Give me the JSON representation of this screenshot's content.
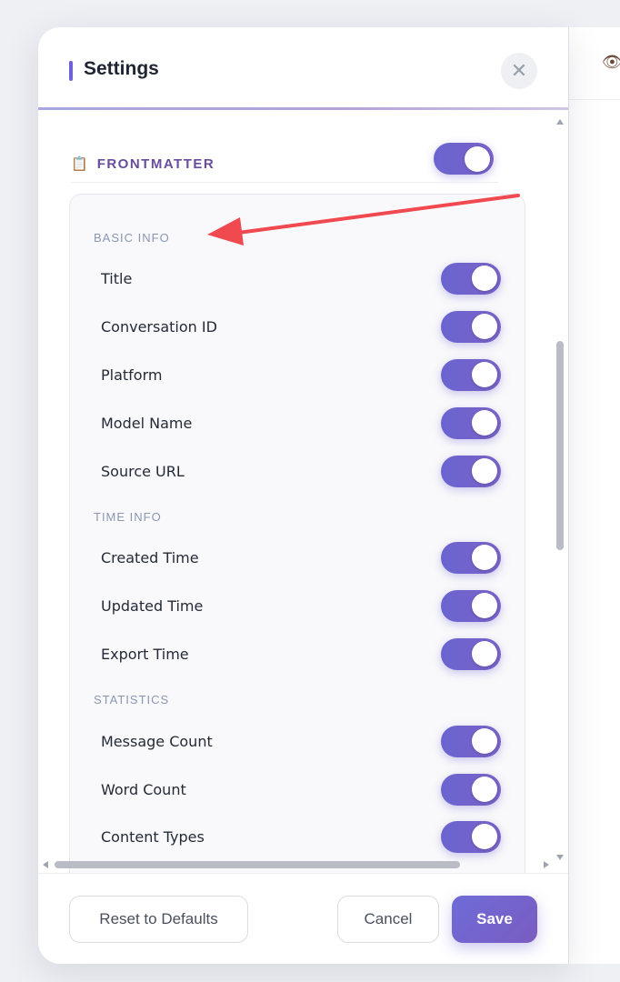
{
  "background_panel": {
    "icon": "eye-icon",
    "glyph": "👁"
  },
  "modal": {
    "title": "Settings",
    "close_glyph": "✕"
  },
  "section": {
    "emoji": "📋",
    "label": "FRONTMATTER",
    "enabled": true
  },
  "groups": [
    {
      "label": "BASIC INFO"
    },
    {
      "label": "TIME INFO"
    },
    {
      "label": "STATISTICS"
    }
  ],
  "rows": [
    {
      "label": "Title",
      "enabled": true
    },
    {
      "label": "Conversation ID",
      "enabled": true
    },
    {
      "label": "Platform",
      "enabled": true
    },
    {
      "label": "Model Name",
      "enabled": true
    },
    {
      "label": "Source URL",
      "enabled": true
    },
    {
      "label": "Created Time",
      "enabled": true
    },
    {
      "label": "Updated Time",
      "enabled": true
    },
    {
      "label": "Export Time",
      "enabled": true
    },
    {
      "label": "Message Count",
      "enabled": true
    },
    {
      "label": "Word Count",
      "enabled": true
    },
    {
      "label": "Content Types",
      "enabled": true
    }
  ],
  "footer": {
    "reset_label": "Reset to Defaults",
    "cancel_label": "Cancel",
    "save_label": "Save"
  },
  "colors": {
    "accent": "#6e62d6",
    "section_label": "#6a4c9c",
    "toggle_on": "#6a64d0",
    "annotation_arrow": "#f0494f"
  }
}
